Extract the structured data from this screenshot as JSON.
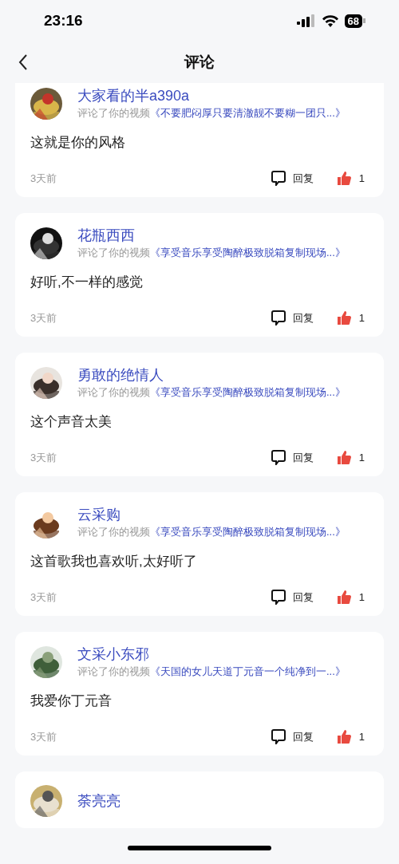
{
  "status_bar": {
    "time": "23:16",
    "battery": "68"
  },
  "nav": {
    "title": "评论"
  },
  "comments": [
    {
      "name": "大家看的半a390a",
      "action": "评论了你的视频",
      "video": "《不要肥闷厚只要清澈靓不要糊一团只...》",
      "text": "这就是你的风格",
      "time": "3天前",
      "reply": "回复",
      "likes": "1",
      "liked": true
    },
    {
      "name": "花瓶西西",
      "action": "评论了你的视频",
      "video": "《享受音乐享受陶醉极致脱箱复制现场...》",
      "text": "好听,不一样的感觉",
      "time": "3天前",
      "reply": "回复",
      "likes": "1",
      "liked": true
    },
    {
      "name": "勇敢的绝情人",
      "action": "评论了你的视频",
      "video": "《享受音乐享受陶醉极致脱箱复制现场...》",
      "text": "这个声音太美",
      "time": "3天前",
      "reply": "回复",
      "likes": "1",
      "liked": true
    },
    {
      "name": "云采购",
      "action": "评论了你的视频",
      "video": "《享受音乐享受陶醉极致脱箱复制现场...》",
      "text": "这首歌我也喜欢听,太好听了",
      "time": "3天前",
      "reply": "回复",
      "likes": "1",
      "liked": true
    },
    {
      "name": "文采小东邪",
      "action": "评论了你的视频",
      "video": "《天国的女儿天道丁元音一个纯净到一...》",
      "text": "我爱你丁元音",
      "time": "3天前",
      "reply": "回复",
      "likes": "1",
      "liked": true
    },
    {
      "name": "荼亮亮"
    }
  ]
}
